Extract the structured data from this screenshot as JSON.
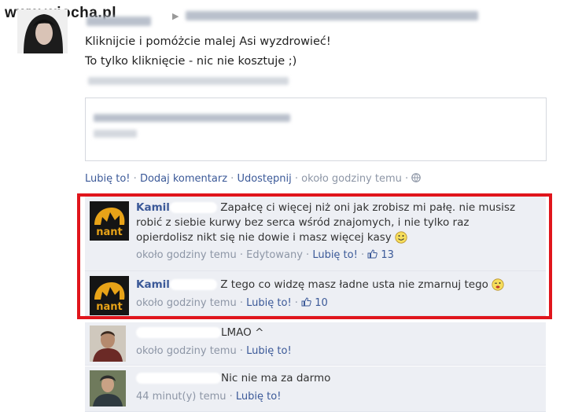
{
  "watermark": "www.wiocha.pl",
  "post": {
    "line1": "Kliknijcie i pomóżcie malej Asi wyzdrowieć!",
    "line2": "To tylko kliknięcie - nic nie kosztuje ;)"
  },
  "actions": {
    "like": "Lubię to!",
    "comment": "Dodaj komentarz",
    "share": "Udostępnij",
    "time": "około godziny temu",
    "sep": "·"
  },
  "comments": [
    {
      "name": "Kamil",
      "text1": "Zapałcę ci więcej niż oni jak zrobisz mi pałę. nie musisz",
      "text2": "robić z siebie kurwy bez serca wśród znajomych, i nie tylko raz",
      "text3": "opierdolisz nikt się nie dowie i masz więcej kasy",
      "time": "około godziny temu",
      "edited": "Edytowany",
      "like": "Lubię to!",
      "likes": "13"
    },
    {
      "name": "Kamil",
      "text1": "Z tego co widzę masz ładne usta nie zmarnuj tego",
      "time": "około godziny temu",
      "like": "Lubię to!",
      "likes": "10"
    },
    {
      "text1": "LMAO ^",
      "time": "około godziny temu",
      "like": "Lubię to!"
    },
    {
      "text1": "Nic nie ma za darmo",
      "time": "44 minut(y) temu",
      "like": "Lubię to!"
    }
  ],
  "colors": {
    "link": "#3b5998",
    "meta": "#8d96a6",
    "highlight": "#e0151c",
    "comment_bg": "#edeff4"
  },
  "icons": [
    "globe-icon",
    "thumbs-up-icon",
    "smile-emoticon-icon",
    "wink-emoticon-icon"
  ]
}
